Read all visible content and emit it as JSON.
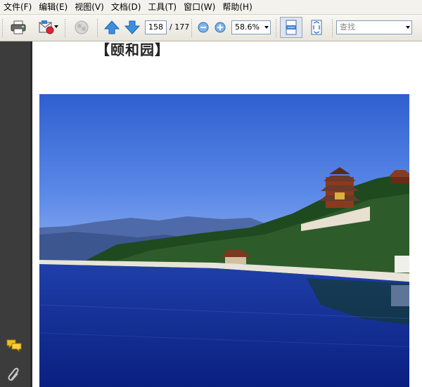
{
  "menu": [
    "文件(F)",
    "编辑(E)",
    "视图(V)",
    "文档(D)",
    "工具(T)",
    "窗口(W)",
    "帮助(H)"
  ],
  "toolbar": {
    "page_current": "158",
    "page_total": "/ 177",
    "zoom": "58.6%",
    "search_placeholder": "查找"
  },
  "document": {
    "title": "【颐和园】"
  },
  "icons": {
    "print": "printer-icon",
    "email": "email-icon",
    "collaborate": "collaborate-icon",
    "prev": "prev-page-icon",
    "next": "next-page-icon",
    "zoom_out": "zoom-out-icon",
    "zoom_in": "zoom-in-icon",
    "fit_width": "fit-width-icon",
    "fit_page": "fit-page-icon",
    "comments": "comments-icon",
    "attachments": "attachments-icon"
  },
  "colors": {
    "accent": "#3a7fd5",
    "nav_bg": "#3c3c3c"
  }
}
